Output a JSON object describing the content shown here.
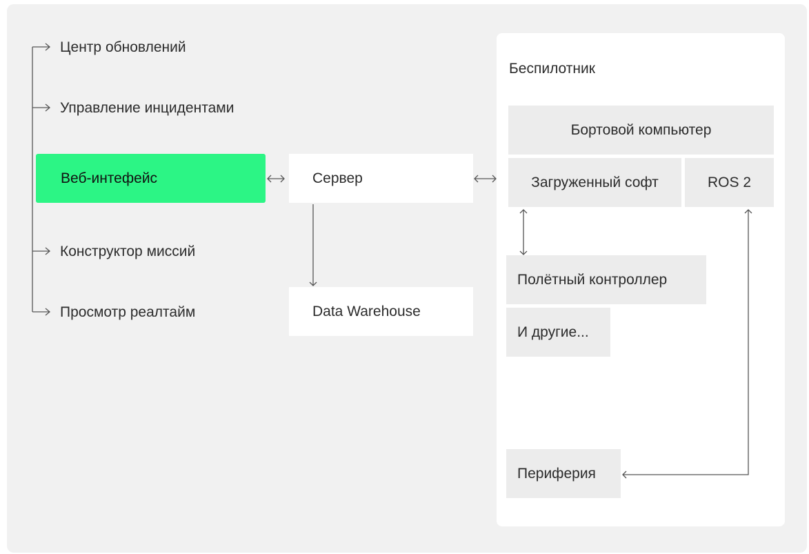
{
  "menu": {
    "updates": "Центр обновлений",
    "incidents": "Управление инцидентами",
    "web": "Веб-интефейс",
    "missions": "Конструктор миссий",
    "realtime": "Просмотр реалтайм"
  },
  "server": "Сервер",
  "warehouse": "Data Warehouse",
  "drone": {
    "title": "Беспилотник",
    "computer": "Бортовой компьютер",
    "software": "Загруженный софт",
    "ros": "ROS 2",
    "controller": "Полётный контроллер",
    "others": "И другие...",
    "periphery": "Периферия"
  },
  "colors": {
    "accent": "#2cf585",
    "panel": "#f1f1f1",
    "block": "#ececec"
  }
}
